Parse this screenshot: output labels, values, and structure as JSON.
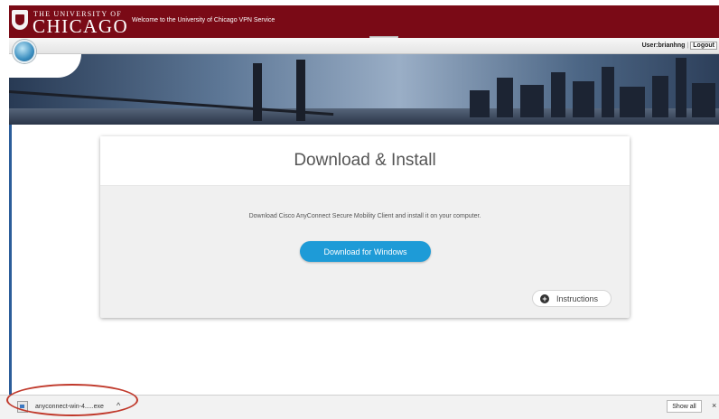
{
  "header": {
    "university_line": "THE UNIVERSITY OF",
    "university_name": "CHICAGO",
    "welcome": "Welcome to the University of Chicago VPN Service",
    "brand_color": "#7a0a16"
  },
  "subbar": {
    "user_label": "User:brianhng",
    "logout_label": "Logout"
  },
  "card": {
    "title": "Download & Install",
    "description": "Download Cisco AnyConnect Secure Mobility Client and install it on your computer.",
    "download_button": "Download for Windows",
    "instructions_button": "Instructions",
    "accent_color": "#1e9bd7"
  },
  "download_bar": {
    "file_name": "anyconnect-win-4.....exe",
    "show_all": "Show all",
    "chevron": "^",
    "close": "×",
    "annotation_color": "#c0392b"
  },
  "icons": {
    "university_shield": "shield-icon",
    "globe": "globe-icon",
    "instructions": "plus-circle-icon",
    "file": "file-icon"
  }
}
